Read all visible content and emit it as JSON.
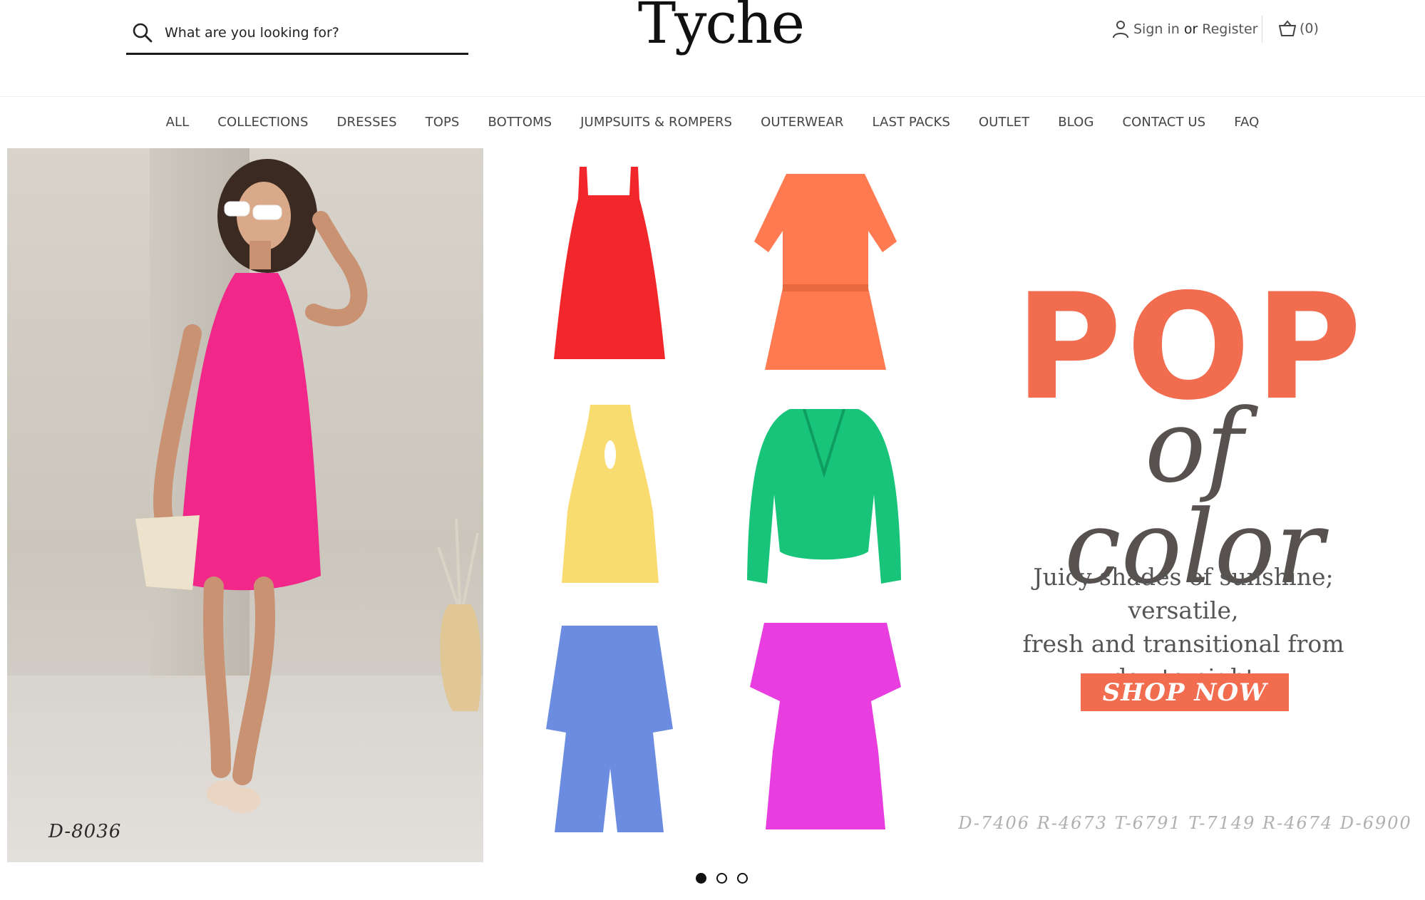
{
  "brand": {
    "logo": "Tyche"
  },
  "search": {
    "placeholder": "What are you looking for?"
  },
  "account": {
    "sign_in": "Sign in",
    "or": "or",
    "register": "Register"
  },
  "cart": {
    "count_label": "(0)"
  },
  "nav": {
    "items": [
      "ALL",
      "COLLECTIONS",
      "DRESSES",
      "TOPS",
      "BOTTOMS",
      "JUMPSUITS & ROMPERS",
      "OUTERWEAR",
      "LAST PACKS",
      "OUTLET",
      "BLOG",
      "CONTACT US",
      "FAQ"
    ]
  },
  "hero": {
    "photo_code": "D-8036",
    "headline": "POP",
    "subheadline": "of color",
    "tagline_line1": "Juicy shades of sunshine; versatile,",
    "tagline_line2": "fresh and transitional from",
    "tagline_line3": "day to night",
    "cta": "SHOP NOW",
    "product_codes": "D-7406  R-4673  T-6791  T-7149  R-4674  D-6900",
    "accent_color": "#f26c4f",
    "garment_colors": [
      "#f2272b",
      "#ff7a50",
      "#f8dc70",
      "#18c47a",
      "#6b8ce0",
      "#e83ee0"
    ]
  },
  "carousel": {
    "slides": 3,
    "active_index": 0
  }
}
